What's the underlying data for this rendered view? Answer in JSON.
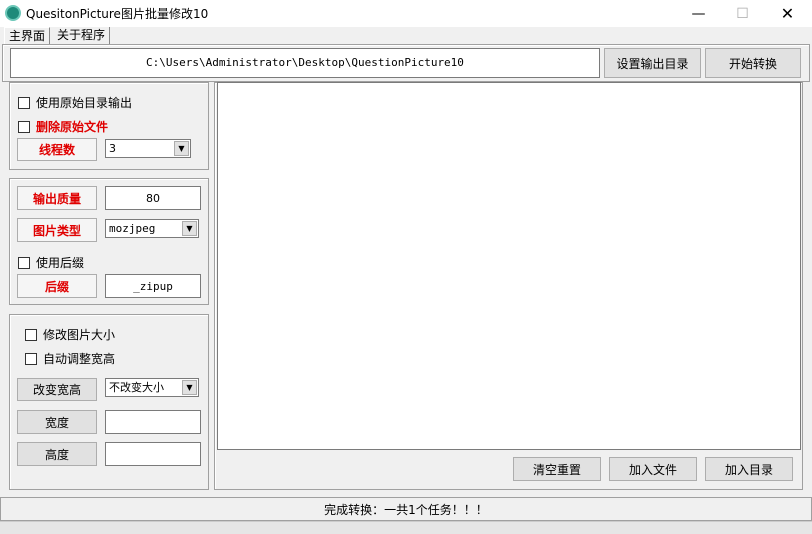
{
  "window": {
    "title": "QuesitonPicture图片批量修改10",
    "minimize": "—",
    "maximize": "☐",
    "close": "✕"
  },
  "tabs": [
    {
      "label": "主界面",
      "active": true
    },
    {
      "label": "关于程序",
      "active": false
    }
  ],
  "top": {
    "path_value": "C:\\Users\\Administrator\\Desktop\\QuestionPicture10",
    "set_output_label": "设置输出目录",
    "start_label": "开始转换"
  },
  "group1": {
    "use_original_dir": "使用原始目录输出",
    "delete_original": "删除原始文件",
    "threads_label": "线程数",
    "threads_value": "3"
  },
  "group2": {
    "quality_label": "输出质量",
    "quality_value": "80",
    "type_label": "图片类型",
    "type_value": "mozjpeg",
    "use_suffix": "使用后缀",
    "suffix_label": "后缀",
    "suffix_value": "_zipup"
  },
  "group3": {
    "resize": "修改图片大小",
    "auto_adjust": "自动调整宽高",
    "change_wh_label": "改变宽高",
    "change_wh_value": "不改变大小",
    "width_label": "宽度",
    "width_value": "",
    "height_label": "高度",
    "height_value": ""
  },
  "actions": {
    "clear_label": "清空重置",
    "add_file_label": "加入文件",
    "add_dir_label": "加入目录"
  },
  "status_text": "完成转换：一共1个任务！！！"
}
